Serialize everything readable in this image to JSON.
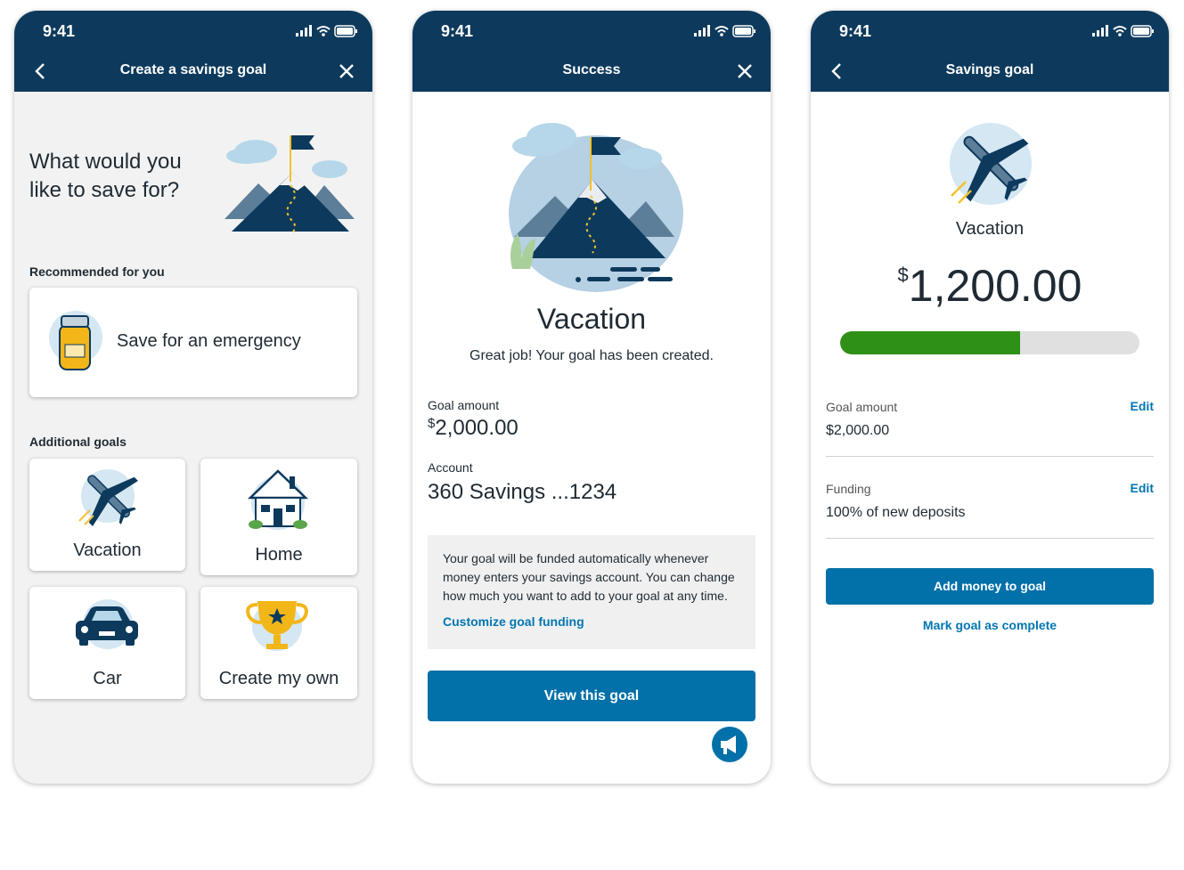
{
  "screens": [
    {
      "status_time": "9:41",
      "title": "Create a savings goal",
      "question": "What would you like to save for?",
      "recommended_label": "Recommended for you",
      "recommended_card": "Save for an emergency",
      "additional_label": "Additional goals",
      "goals": [
        "Vacation",
        "Home",
        "Car",
        "Create my own"
      ]
    },
    {
      "status_time": "9:41",
      "title": "Success",
      "goal_name": "Vacation",
      "message": "Great job! Your goal has been created.",
      "goal_amount_label": "Goal amount",
      "goal_amount_symbol": "$",
      "goal_amount_value": "2,000.00",
      "account_label": "Account",
      "account_value": "360 Savings ...1234",
      "info_text": "Your goal will be funded automatically whenever money enters your savings account. You can change how much you want to add to your goal at any time.",
      "info_link": "Customize goal funding",
      "primary_button": "View this goal"
    },
    {
      "status_time": "9:41",
      "title": "Savings goal",
      "goal_name": "Vacation",
      "saved_symbol": "$",
      "saved_value": "1,200.00",
      "progress_fraction": 0.6,
      "goal_amount_label": "Goal amount",
      "goal_amount_value": "$2,000.00",
      "funding_label": "Funding",
      "funding_value": "100% of new deposits",
      "edit_label": "Edit",
      "primary_button": "Add money to goal",
      "secondary_link": "Mark goal as complete"
    }
  ],
  "colors": {
    "header": "#0d3a5c",
    "primary": "#0270a9",
    "link": "#0276b1",
    "progress": "#2e9016",
    "progress_track": "#e0e0e0"
  }
}
